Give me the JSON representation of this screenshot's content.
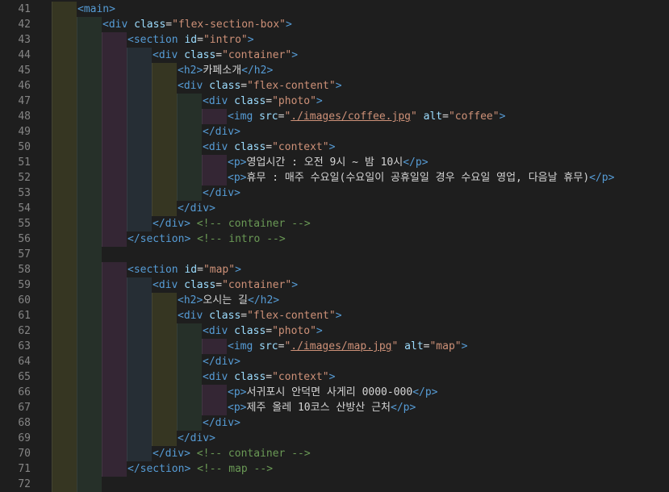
{
  "editor": {
    "theme_colors": {
      "background": "#1e1e1e",
      "line_number": "#858585",
      "tag": "#569cd6",
      "attribute": "#9cdcfe",
      "string": "#ce9178",
      "text": "#d4d4d4",
      "comment": "#6a9955"
    },
    "lines": [
      {
        "num": "41",
        "indent": 1,
        "tokens": [
          {
            "t": "tag",
            "v": "<main>"
          }
        ]
      },
      {
        "num": "42",
        "indent": 2,
        "tokens": [
          {
            "t": "tag",
            "v": "<div "
          },
          {
            "t": "attr",
            "v": "class"
          },
          {
            "t": "text",
            "v": "="
          },
          {
            "t": "str",
            "v": "\"flex-section-box\""
          },
          {
            "t": "tag",
            "v": ">"
          }
        ]
      },
      {
        "num": "43",
        "indent": 3,
        "tokens": [
          {
            "t": "tag",
            "v": "<section "
          },
          {
            "t": "attr",
            "v": "id"
          },
          {
            "t": "text",
            "v": "="
          },
          {
            "t": "str",
            "v": "\"intro\""
          },
          {
            "t": "tag",
            "v": ">"
          }
        ]
      },
      {
        "num": "44",
        "indent": 4,
        "tokens": [
          {
            "t": "tag",
            "v": "<div "
          },
          {
            "t": "attr",
            "v": "class"
          },
          {
            "t": "text",
            "v": "="
          },
          {
            "t": "str",
            "v": "\"container\""
          },
          {
            "t": "tag",
            "v": ">"
          }
        ]
      },
      {
        "num": "45",
        "indent": 5,
        "tokens": [
          {
            "t": "tag",
            "v": "<h2>"
          },
          {
            "t": "text",
            "v": "카페소개"
          },
          {
            "t": "tag",
            "v": "</h2>"
          }
        ]
      },
      {
        "num": "46",
        "indent": 5,
        "tokens": [
          {
            "t": "tag",
            "v": "<div "
          },
          {
            "t": "attr",
            "v": "class"
          },
          {
            "t": "text",
            "v": "="
          },
          {
            "t": "str",
            "v": "\"flex-content\""
          },
          {
            "t": "tag",
            "v": ">"
          }
        ]
      },
      {
        "num": "47",
        "indent": 6,
        "tokens": [
          {
            "t": "tag",
            "v": "<div "
          },
          {
            "t": "attr",
            "v": "class"
          },
          {
            "t": "text",
            "v": "="
          },
          {
            "t": "str",
            "v": "\"photo\""
          },
          {
            "t": "tag",
            "v": ">"
          }
        ]
      },
      {
        "num": "48",
        "indent": 7,
        "tokens": [
          {
            "t": "tag",
            "v": "<img "
          },
          {
            "t": "attr",
            "v": "src"
          },
          {
            "t": "text",
            "v": "="
          },
          {
            "t": "str",
            "v": "\""
          },
          {
            "t": "link",
            "v": "./images/coffee.jpg"
          },
          {
            "t": "str",
            "v": "\""
          },
          {
            "t": "text",
            "v": " "
          },
          {
            "t": "attr",
            "v": "alt"
          },
          {
            "t": "text",
            "v": "="
          },
          {
            "t": "str",
            "v": "\"coffee\""
          },
          {
            "t": "tag",
            "v": ">"
          }
        ]
      },
      {
        "num": "49",
        "indent": 6,
        "tokens": [
          {
            "t": "tag",
            "v": "</div>"
          }
        ]
      },
      {
        "num": "50",
        "indent": 6,
        "tokens": [
          {
            "t": "tag",
            "v": "<div "
          },
          {
            "t": "attr",
            "v": "class"
          },
          {
            "t": "text",
            "v": "="
          },
          {
            "t": "str",
            "v": "\"context\""
          },
          {
            "t": "tag",
            "v": ">"
          }
        ]
      },
      {
        "num": "51",
        "indent": 7,
        "tokens": [
          {
            "t": "tag",
            "v": "<p>"
          },
          {
            "t": "text",
            "v": "영업시간 : 오전 9시 ~ 밤 10시"
          },
          {
            "t": "tag",
            "v": "</p>"
          }
        ]
      },
      {
        "num": "52",
        "indent": 7,
        "tokens": [
          {
            "t": "tag",
            "v": "<p>"
          },
          {
            "t": "text",
            "v": "휴무 : 매주 수요일(수요일이 공휴일일 경우 수요일 영업, 다음날 휴무)"
          },
          {
            "t": "tag",
            "v": "</p>"
          }
        ]
      },
      {
        "num": "53",
        "indent": 6,
        "tokens": [
          {
            "t": "tag",
            "v": "</div>"
          }
        ]
      },
      {
        "num": "54",
        "indent": 5,
        "tokens": [
          {
            "t": "tag",
            "v": "</div>"
          }
        ]
      },
      {
        "num": "55",
        "indent": 4,
        "tokens": [
          {
            "t": "tag",
            "v": "</div>"
          },
          {
            "t": "text",
            "v": " "
          },
          {
            "t": "com",
            "v": "<!-- container -->"
          }
        ]
      },
      {
        "num": "56",
        "indent": 3,
        "tokens": [
          {
            "t": "tag",
            "v": "</section>"
          },
          {
            "t": "text",
            "v": " "
          },
          {
            "t": "com",
            "v": "<!-- intro -->"
          }
        ]
      },
      {
        "num": "57",
        "indent": 2,
        "tokens": []
      },
      {
        "num": "58",
        "indent": 3,
        "tokens": [
          {
            "t": "tag",
            "v": "<section "
          },
          {
            "t": "attr",
            "v": "id"
          },
          {
            "t": "text",
            "v": "="
          },
          {
            "t": "str",
            "v": "\"map\""
          },
          {
            "t": "tag",
            "v": ">"
          }
        ]
      },
      {
        "num": "59",
        "indent": 4,
        "tokens": [
          {
            "t": "tag",
            "v": "<div "
          },
          {
            "t": "attr",
            "v": "class"
          },
          {
            "t": "text",
            "v": "="
          },
          {
            "t": "str",
            "v": "\"container\""
          },
          {
            "t": "tag",
            "v": ">"
          }
        ]
      },
      {
        "num": "60",
        "indent": 5,
        "tokens": [
          {
            "t": "tag",
            "v": "<h2>"
          },
          {
            "t": "text",
            "v": "오시는 길"
          },
          {
            "t": "tag",
            "v": "</h2>"
          }
        ]
      },
      {
        "num": "61",
        "indent": 5,
        "tokens": [
          {
            "t": "tag",
            "v": "<div "
          },
          {
            "t": "attr",
            "v": "class"
          },
          {
            "t": "text",
            "v": "="
          },
          {
            "t": "str",
            "v": "\"flex-content\""
          },
          {
            "t": "tag",
            "v": ">"
          }
        ]
      },
      {
        "num": "62",
        "indent": 6,
        "tokens": [
          {
            "t": "tag",
            "v": "<div "
          },
          {
            "t": "attr",
            "v": "class"
          },
          {
            "t": "text",
            "v": "="
          },
          {
            "t": "str",
            "v": "\"photo\""
          },
          {
            "t": "tag",
            "v": ">"
          }
        ]
      },
      {
        "num": "63",
        "indent": 7,
        "tokens": [
          {
            "t": "tag",
            "v": "<img "
          },
          {
            "t": "attr",
            "v": "src"
          },
          {
            "t": "text",
            "v": "="
          },
          {
            "t": "str",
            "v": "\""
          },
          {
            "t": "link",
            "v": "./images/map.jpg"
          },
          {
            "t": "str",
            "v": "\""
          },
          {
            "t": "text",
            "v": " "
          },
          {
            "t": "attr",
            "v": "alt"
          },
          {
            "t": "text",
            "v": "="
          },
          {
            "t": "str",
            "v": "\"map\""
          },
          {
            "t": "tag",
            "v": ">"
          }
        ]
      },
      {
        "num": "64",
        "indent": 6,
        "tokens": [
          {
            "t": "tag",
            "v": "</div>"
          }
        ]
      },
      {
        "num": "65",
        "indent": 6,
        "tokens": [
          {
            "t": "tag",
            "v": "<div "
          },
          {
            "t": "attr",
            "v": "class"
          },
          {
            "t": "text",
            "v": "="
          },
          {
            "t": "str",
            "v": "\"context\""
          },
          {
            "t": "tag",
            "v": ">"
          }
        ]
      },
      {
        "num": "66",
        "indent": 7,
        "tokens": [
          {
            "t": "tag",
            "v": "<p>"
          },
          {
            "t": "text",
            "v": "서귀포시 안덕면 사게리 0000-000"
          },
          {
            "t": "tag",
            "v": "</p>"
          }
        ]
      },
      {
        "num": "67",
        "indent": 7,
        "tokens": [
          {
            "t": "tag",
            "v": "<p>"
          },
          {
            "t": "text",
            "v": "제주 올레 10코스 산방산 근처"
          },
          {
            "t": "tag",
            "v": "</p>"
          }
        ]
      },
      {
        "num": "68",
        "indent": 6,
        "tokens": [
          {
            "t": "tag",
            "v": "</div>"
          }
        ]
      },
      {
        "num": "69",
        "indent": 5,
        "tokens": [
          {
            "t": "tag",
            "v": "</div>"
          }
        ]
      },
      {
        "num": "70",
        "indent": 4,
        "tokens": [
          {
            "t": "tag",
            "v": "</div>"
          },
          {
            "t": "text",
            "v": " "
          },
          {
            "t": "com",
            "v": "<!-- container -->"
          }
        ]
      },
      {
        "num": "71",
        "indent": 3,
        "tokens": [
          {
            "t": "tag",
            "v": "</section>"
          },
          {
            "t": "text",
            "v": " "
          },
          {
            "t": "com",
            "v": "<!-- map -->"
          }
        ]
      },
      {
        "num": "72",
        "indent": 2,
        "tokens": []
      }
    ]
  }
}
